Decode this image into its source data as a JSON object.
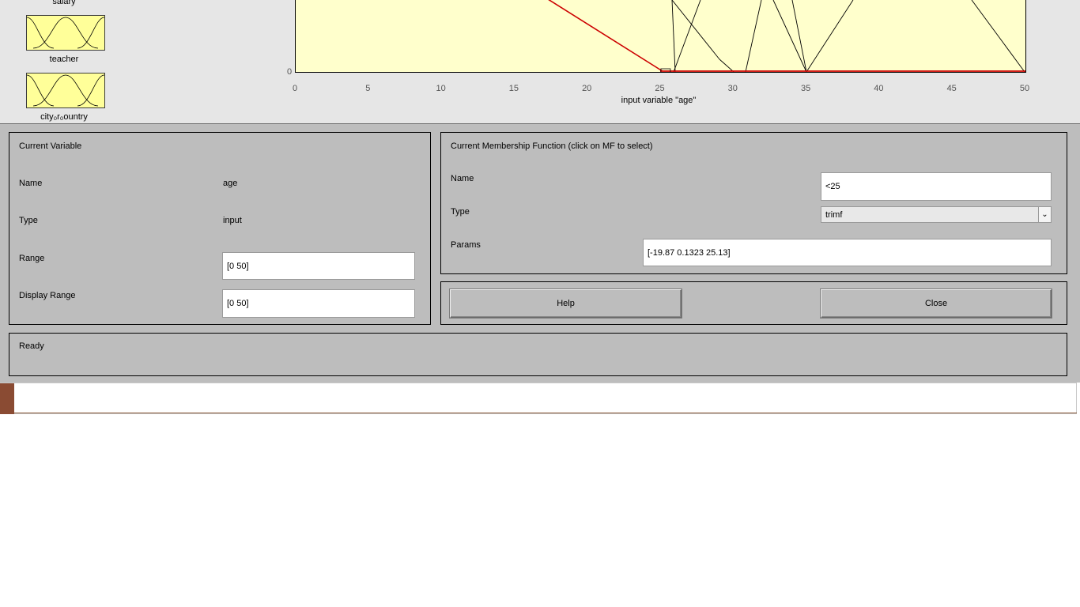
{
  "window": {
    "variable_list": [
      {
        "label": "salary"
      },
      {
        "label": "teacher"
      },
      {
        "label": "city_or_country_label",
        "text": "cityorcountry",
        "display": "city₀r₀ountry"
      }
    ]
  },
  "plot": {
    "x_ticks": [
      "0",
      "5",
      "10",
      "15",
      "20",
      "25",
      "30",
      "35",
      "40",
      "45",
      "50"
    ],
    "y_zero": "0",
    "x_axis_title": "input variable \"age\"",
    "selected_color": "#cc0000",
    "background_color": "#ffffcc"
  },
  "chart_data": {
    "type": "line",
    "x_range": [
      0,
      50
    ],
    "y_range": [
      0,
      1
    ],
    "xlabel": "input variable \"age\"",
    "series": [
      {
        "name": "<25",
        "selected": true,
        "points": [
          [
            -19.87,
            0
          ],
          [
            0.1323,
            1
          ],
          [
            25.13,
            0
          ]
        ]
      }
    ]
  },
  "current_variable": {
    "section_title": "Current Variable",
    "name_label": "Name",
    "name_value": "age",
    "type_label": "Type",
    "type_value": "input",
    "range_label": "Range",
    "range_value": "[0 50]",
    "display_range_label": "Display Range",
    "display_range_value": "[0 50]"
  },
  "membership_function": {
    "section_title": "Current Membership Function (click on MF to select)",
    "name_label": "Name",
    "name_value": "<25",
    "type_label": "Type",
    "type_value": "trimf",
    "params_label": "Params",
    "params_value": "[-19.87 0.1323 25.13]"
  },
  "buttons": {
    "help_label": "Help",
    "close_label": "Close"
  },
  "status": {
    "text": "Ready"
  }
}
